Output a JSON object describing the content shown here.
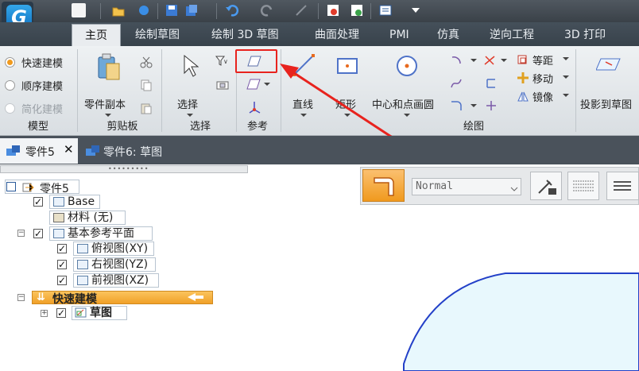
{
  "window": {
    "logo_letter": "G"
  },
  "menu_tabs": [
    {
      "label": "主页",
      "active": true
    },
    {
      "label": "绘制草图"
    },
    {
      "label": "绘制 3D 草图"
    },
    {
      "label": "曲面处理"
    },
    {
      "label": "PMI"
    },
    {
      "label": "仿真"
    },
    {
      "label": "逆向工程"
    },
    {
      "label": "3D 打印"
    }
  ],
  "ribbon": {
    "model_group": {
      "label": "模型",
      "options": [
        "快速建模",
        "顺序建模",
        "简化建模"
      ]
    },
    "clipboard_group": {
      "label": "剪贴板",
      "part_copy": "零件副本"
    },
    "select_group": {
      "label": "选择",
      "select": "选择"
    },
    "reference_group": {
      "label": "参考"
    },
    "draw_group": {
      "label": "绘图",
      "line": "直线",
      "rect": "矩形",
      "circle": "中心和点画圆",
      "offset": "等距",
      "move": "移动",
      "mirror": "镜像",
      "project": "投影到草图"
    }
  },
  "doc_tabs": [
    {
      "label": "零件5",
      "active": true
    },
    {
      "label": "零件6: 草图"
    }
  ],
  "tree": {
    "root": "零件5",
    "items": [
      {
        "label": "Base"
      },
      {
        "label": "材料 (无)"
      },
      {
        "label": "基本参考平面"
      },
      {
        "label": "俯视图(XY)"
      },
      {
        "label": "右视图(YZ)"
      },
      {
        "label": "前视图(XZ)"
      },
      {
        "label": "快速建模"
      },
      {
        "label": "草图"
      }
    ]
  },
  "view_toolbar": {
    "style_value": "Normal"
  },
  "colors": {
    "accent": "#f09a1e",
    "annotation_red": "#e8231e",
    "sketch_fill": "#e8f8fd",
    "sketch_stroke": "#2340c8"
  }
}
